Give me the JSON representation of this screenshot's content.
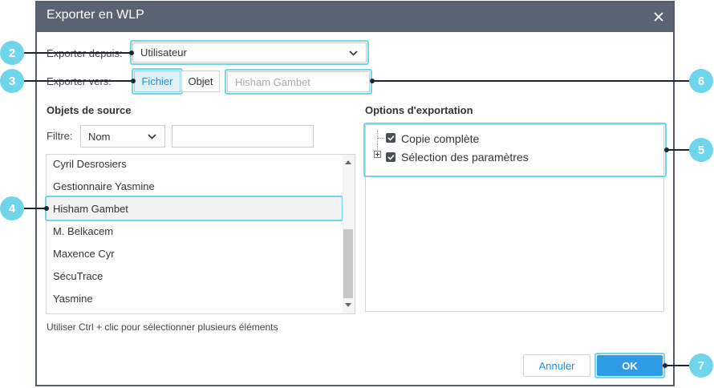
{
  "dialog": {
    "title": "Exporter en WLP"
  },
  "export_from": {
    "label": "Exporter depuis:",
    "value": "Utilisateur"
  },
  "export_to": {
    "label": "Exporter vers:",
    "file_label": "Fichier",
    "object_label": "Objet",
    "input_value": "Hisham Gambet"
  },
  "source": {
    "heading": "Objets de source",
    "filter_label": "Filtre:",
    "filter_value": "Nom",
    "filter_input": "",
    "items": [
      "Cyril Desrosiers",
      "Gestionnaire Yasmine",
      "Hisham Gambet",
      "M. Belkacem",
      "Maxence Cyr",
      "SécuTrace",
      "Yasmine"
    ],
    "hint": "Utiliser Ctrl + clic pour sélectionner plusieurs éléments"
  },
  "options": {
    "heading": "Options d'exportation",
    "items": [
      "Copie complète",
      "Sélection des paramètres"
    ]
  },
  "buttons": {
    "cancel": "Annuler",
    "ok": "OK"
  },
  "callouts": {
    "c2": "2",
    "c3": "3",
    "c4": "4",
    "c5": "5",
    "c6": "6",
    "c7": "7"
  },
  "colors": {
    "titlebar": "#5a6372",
    "accent": "#2e9be6",
    "highlight": "#6fd5ea"
  }
}
